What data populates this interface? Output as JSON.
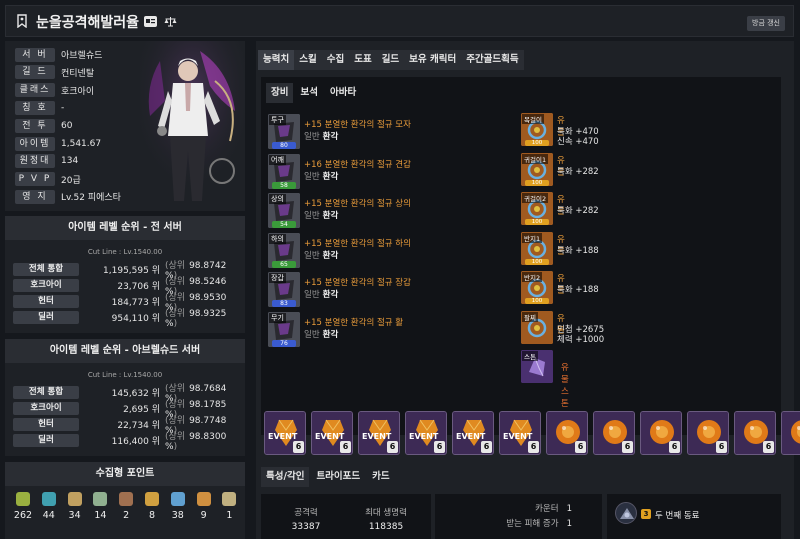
{
  "header": {
    "title": "눈을공격해발러율",
    "refresh_label": "방금 갱신"
  },
  "profile": {
    "rows": [
      {
        "label": "서 버",
        "value": "아브렐슈드"
      },
      {
        "label": "길 드",
        "value": "컨티넨탈"
      },
      {
        "label": "클래스",
        "value": "호크아이"
      },
      {
        "label": "칭 호",
        "value": "-"
      },
      {
        "label": "전 투",
        "value": "60"
      },
      {
        "label": "아이템",
        "value": "1,541.67"
      },
      {
        "label": "원정대",
        "value": "134"
      },
      {
        "label": "P V P",
        "value": "20급"
      },
      {
        "label": "영 지",
        "value": "Lv.52 피에스타"
      }
    ]
  },
  "rank_all": {
    "title": "아이템 레벨 순위 - 전 서버",
    "cutline": "Cut Line : Lv.1540.00",
    "rows": [
      {
        "label": "전체 통합",
        "rank": "1,195,595 위",
        "pct": "98.8742 %"
      },
      {
        "label": "호크아이",
        "rank": "23,706 위",
        "pct": "98.5246 %"
      },
      {
        "label": "헌터",
        "rank": "184,773 위",
        "pct": "98.9530 %"
      },
      {
        "label": "딜러",
        "rank": "954,110 위",
        "pct": "98.9325 %"
      }
    ]
  },
  "rank_server": {
    "title": "아이템 레벨 순위 - 아브렐슈드 서버",
    "cutline": "Cut Line : Lv.1540.00",
    "rows": [
      {
        "label": "전체 통합",
        "rank": "145,632 위",
        "pct": "98.7684 %"
      },
      {
        "label": "호크아이",
        "rank": "2,695 위",
        "pct": "98.1785 %"
      },
      {
        "label": "헌터",
        "rank": "22,734 위",
        "pct": "98.7748 %"
      },
      {
        "label": "딜러",
        "rank": "116,400 위",
        "pct": "98.8300 %"
      }
    ]
  },
  "rank_labels": {
    "open": "(상위",
    "close": ")"
  },
  "collection": {
    "title": "수집형 포인트",
    "items": [
      {
        "icon": "seed-icon",
        "count": "262",
        "color": "#9ab040"
      },
      {
        "icon": "island-icon",
        "count": "44",
        "color": "#40a0b0"
      },
      {
        "icon": "art-icon",
        "count": "34",
        "color": "#c0a060"
      },
      {
        "icon": "heart-icon",
        "count": "14",
        "color": "#90b090"
      },
      {
        "icon": "yeti-icon",
        "count": "2",
        "color": "#a07050"
      },
      {
        "icon": "sword-icon",
        "count": "8",
        "color": "#d0a040"
      },
      {
        "icon": "star-icon",
        "count": "38",
        "color": "#60a0d0"
      },
      {
        "icon": "world-tree-icon",
        "count": "9",
        "color": "#d09040"
      },
      {
        "icon": "medal-icon",
        "count": "1",
        "color": "#c0b080"
      }
    ]
  },
  "main_tabs": [
    "능력치",
    "스킬",
    "수집",
    "도표",
    "길드",
    "보유 캐릭터",
    "주간골드획득"
  ],
  "sub_tabs": [
    "장비",
    "보석",
    "아바타"
  ],
  "equipment": [
    {
      "slot": "투구",
      "name": "+15 분열한 환각의 절규 모자",
      "grade": "일반",
      "type": "환각",
      "quality": "80",
      "qcolor": "#3a5bd0"
    },
    {
      "slot": "어깨",
      "name": "+16 분열한 환각의 절규 견갑",
      "grade": "일반",
      "type": "환각",
      "quality": "58",
      "qcolor": "#3a9a3a"
    },
    {
      "slot": "상의",
      "name": "+15 분열한 환각의 절규 상의",
      "grade": "일반",
      "type": "환각",
      "quality": "54",
      "qcolor": "#3a9a3a"
    },
    {
      "slot": "하의",
      "name": "+15 분열한 환각의 절규 하의",
      "grade": "일반",
      "type": "환각",
      "quality": "65",
      "qcolor": "#3a9a3a"
    },
    {
      "slot": "장갑",
      "name": "+15 분열한 환각의 절규 장갑",
      "grade": "일반",
      "type": "환각",
      "quality": "83",
      "qcolor": "#3a5bd0"
    },
    {
      "slot": "무기",
      "name": "+15 분열한 환각의 절규 활",
      "grade": "일반",
      "type": "환각",
      "quality": "76",
      "qcolor": "#3a5bd0"
    }
  ],
  "accessories": [
    {
      "slot": "목걸이",
      "grade": "유물",
      "stats": [
        "특화 +470",
        "신속 +470"
      ],
      "quality": "100"
    },
    {
      "slot": "귀걸이1",
      "grade": "유물",
      "stats": [
        "특화 +282"
      ],
      "quality": "100"
    },
    {
      "slot": "귀걸이2",
      "grade": "유물",
      "stats": [
        "특화 +282"
      ],
      "quality": "100"
    },
    {
      "slot": "반지1",
      "grade": "유물",
      "stats": [
        "특화 +188"
      ],
      "quality": "100"
    },
    {
      "slot": "반지2",
      "grade": "유물",
      "stats": [
        "특화 +188"
      ],
      "quality": "100"
    },
    {
      "slot": "팔찌",
      "grade": "유물",
      "stats": [
        "민첩 +2675",
        "체력 +1000"
      ],
      "quality": ""
    }
  ],
  "stone": {
    "slot": "스톤",
    "label": "유물 스톤"
  },
  "gems": [
    {
      "label": "EVENT",
      "level": "6",
      "kind": "event"
    },
    {
      "label": "EVENT",
      "level": "6",
      "kind": "event"
    },
    {
      "label": "EVENT",
      "level": "6",
      "kind": "event"
    },
    {
      "label": "EVENT",
      "level": "6",
      "kind": "event"
    },
    {
      "label": "EVENT",
      "level": "6",
      "kind": "event"
    },
    {
      "label": "EVENT",
      "level": "6",
      "kind": "event"
    },
    {
      "label": "",
      "level": "6",
      "kind": "normal"
    },
    {
      "label": "",
      "level": "6",
      "kind": "normal"
    },
    {
      "label": "",
      "level": "6",
      "kind": "normal"
    },
    {
      "label": "",
      "level": "6",
      "kind": "normal"
    },
    {
      "label": "",
      "level": "6",
      "kind": "normal"
    },
    {
      "label": "",
      "level": "6",
      "kind": "normal"
    }
  ],
  "bottom_tabs": [
    "특성/각인",
    "트라이포드",
    "카드"
  ],
  "stats": [
    {
      "label": "공격력",
      "value": "33387"
    },
    {
      "label": "최대 생명력",
      "value": "118385"
    }
  ],
  "extra_stats": [
    {
      "label": "카운터",
      "value": "1"
    },
    {
      "label": "받는 피해 증가",
      "value": "1"
    }
  ],
  "engraving": {
    "level": "3",
    "name": "두 번째 동료"
  }
}
